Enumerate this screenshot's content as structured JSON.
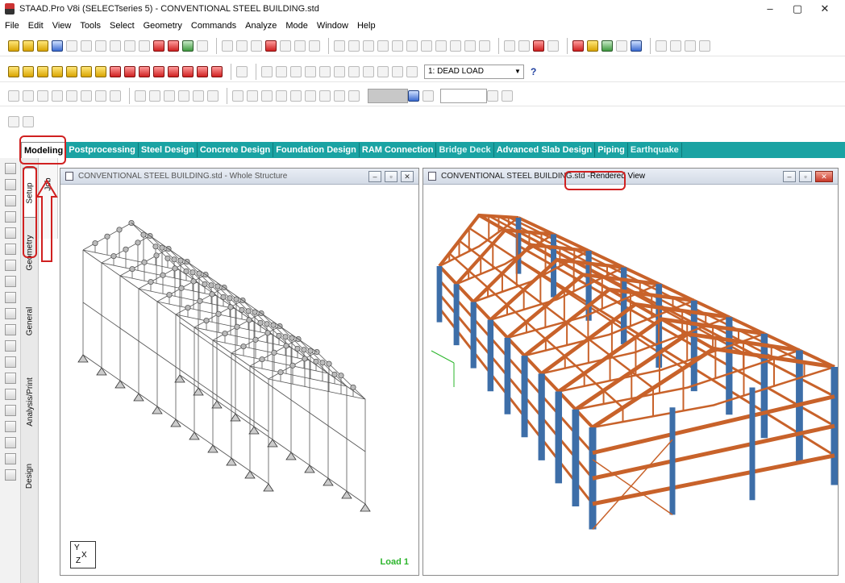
{
  "app": {
    "title": "STAAD.Pro V8i (SELECTseries 5) - CONVENTIONAL STEEL BUILDING.std",
    "window_controls": [
      "–",
      "▢",
      "✕"
    ]
  },
  "menu": [
    "File",
    "Edit",
    "View",
    "Tools",
    "Select",
    "Geometry",
    "Commands",
    "Analyze",
    "Mode",
    "Window",
    "Help"
  ],
  "toolbar": {
    "load_case": "1: DEAD LOAD",
    "help": "?"
  },
  "tabs": [
    {
      "label": "Modeling",
      "active": true
    },
    {
      "label": "Postprocessing"
    },
    {
      "label": "Steel Design"
    },
    {
      "label": "Concrete Design"
    },
    {
      "label": "Foundation Design"
    },
    {
      "label": "RAM Connection"
    },
    {
      "label": "Bridge Deck",
      "dimmed": true
    },
    {
      "label": "Advanced Slab Design"
    },
    {
      "label": "Piping"
    },
    {
      "label": "Earthquake",
      "dimmed": true
    }
  ],
  "vertical_tabs": [
    "Setup",
    "Geometry",
    "General",
    "Analysis/Print",
    "Design"
  ],
  "sub_tab": "Job",
  "left_window": {
    "title": "CONVENTIONAL STEEL BUILDING.std - Whole Structure",
    "load_label": "Load 1",
    "axis": {
      "y": "Y",
      "x": "X",
      "z": "Z"
    }
  },
  "right_window": {
    "title_prefix": "CONVENTIONAL STEEL BUILDING.std - ",
    "title_suffix": "Rendered View"
  },
  "colors": {
    "tab_strip": "#1aa3a3",
    "steel_orange": "#c8622a",
    "column_blue": "#3d6ea8",
    "annotation_red": "#d02020",
    "load_green": "#2bb52b"
  }
}
